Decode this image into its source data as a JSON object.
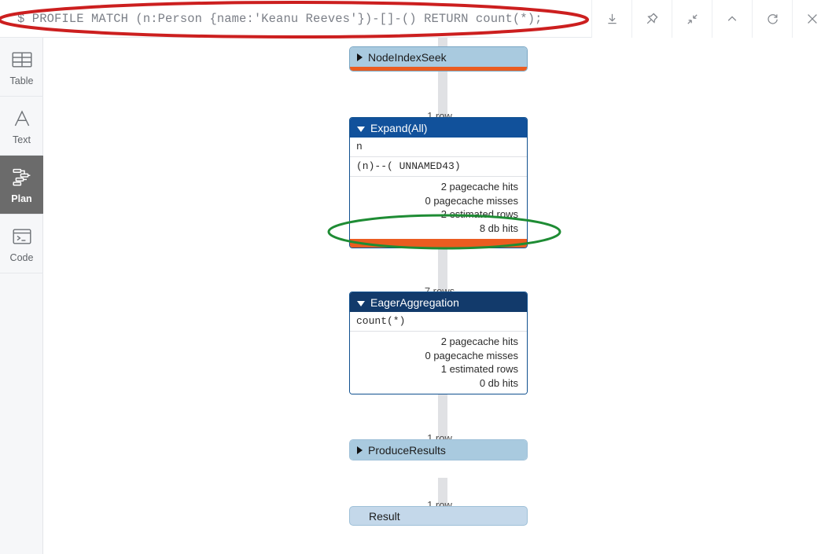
{
  "query_bar": {
    "prompt": "$",
    "query": "$ PROFILE MATCH (n:Person {name:'Keanu Reeves'})-[]-() RETURN count(*);"
  },
  "toolbar": {
    "buttons": [
      {
        "name": "download-icon",
        "label": "Download"
      },
      {
        "name": "pin-icon",
        "label": "Pin"
      },
      {
        "name": "contract-icon",
        "label": "Contract"
      },
      {
        "name": "chevron-up-icon",
        "label": "Collapse"
      },
      {
        "name": "refresh-icon",
        "label": "Rerun"
      },
      {
        "name": "close-icon",
        "label": "Close"
      }
    ]
  },
  "sidebar": {
    "items": [
      {
        "label": "Table",
        "icon": "table-icon",
        "selected": false
      },
      {
        "label": "Text",
        "icon": "text-icon",
        "selected": false
      },
      {
        "label": "Plan",
        "icon": "plan-icon",
        "selected": true
      },
      {
        "label": "Code",
        "icon": "code-icon",
        "selected": false
      }
    ]
  },
  "plan": {
    "nodes": [
      {
        "id": "node-index-seek",
        "operator": "NodeIndexSeek",
        "state": "collapsed",
        "has_db_hits_bar": true,
        "rows_label": "1 row"
      },
      {
        "id": "expand-all",
        "operator": "Expand(All)",
        "state": "expanded",
        "identifiers": "n",
        "pattern": "(n)--(  UNNAMED43)",
        "stats": [
          "2 pagecache hits",
          "0 pagecache misses",
          "2 estimated rows",
          "8 db hits"
        ],
        "has_db_hits_bar": true,
        "rows_label": "7 rows"
      },
      {
        "id": "eager-aggregation",
        "operator": "EagerAggregation",
        "state": "expanded",
        "identifiers": "count(*)",
        "stats": [
          "2 pagecache hits",
          "0 pagecache misses",
          "1 estimated rows",
          "0 db hits"
        ],
        "has_db_hits_bar": false,
        "rows_label": "1 row"
      },
      {
        "id": "produce-results",
        "operator": "ProduceResults",
        "state": "collapsed",
        "has_db_hits_bar": false,
        "rows_label": "1 row"
      },
      {
        "id": "result",
        "operator": "Result",
        "state": "terminal",
        "has_db_hits_bar": false,
        "rows_label": ""
      }
    ]
  },
  "annotations": {
    "query_highlight_color": "#cc1f1f",
    "db_hits_highlight_color": "#1e8c34"
  },
  "colors": {
    "collapsed_node": "#a9cadf",
    "expanded_header": "#11519b",
    "aggregation_header": "#123a6b",
    "db_hits_bar": "#eb5c20",
    "result_node": "#c4d8ea",
    "connector": "#e0e1e4",
    "sidebar_selected": "#6b6b6b"
  }
}
